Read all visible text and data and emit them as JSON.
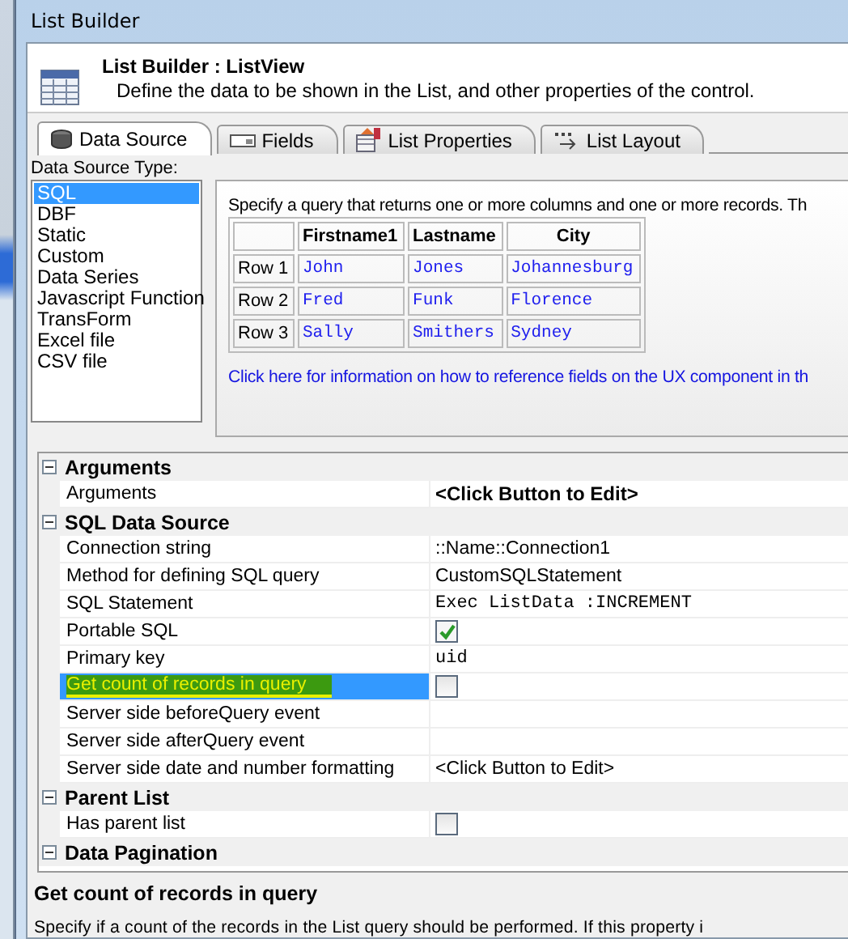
{
  "window": {
    "title": "List Builder"
  },
  "header": {
    "title": "List Builder : ListView",
    "description": "Define the data to be shown in the List, and other properties of the control."
  },
  "tabs": [
    {
      "label": "Data Source",
      "selected": true
    },
    {
      "label": "Fields",
      "selected": false
    },
    {
      "label": "List Properties",
      "selected": false
    },
    {
      "label": "List Layout",
      "selected": false
    }
  ],
  "data_source_type": {
    "label": "Data Source Type:",
    "items": [
      {
        "label": "SQL",
        "selected": true
      },
      {
        "label": "DBF",
        "selected": false
      },
      {
        "label": "Static",
        "selected": false
      },
      {
        "label": "Custom",
        "selected": false
      },
      {
        "label": "Data Series",
        "selected": false
      },
      {
        "label": "Javascript Function",
        "selected": false
      },
      {
        "label": "TransForm",
        "selected": false
      },
      {
        "label": "Excel file",
        "selected": false
      },
      {
        "label": "CSV file",
        "selected": false
      }
    ]
  },
  "info_panel": {
    "intro": "Specify a query that returns one or more columns and one or more records. Th",
    "sample_table": {
      "columns": [
        "Firstname1",
        "Lastname",
        "City"
      ],
      "rows": [
        {
          "label": "Row 1",
          "cells": [
            "John",
            "Jones",
            "Johannesburg"
          ]
        },
        {
          "label": "Row 2",
          "cells": [
            "Fred",
            "Funk",
            "Florence"
          ]
        },
        {
          "label": "Row 3",
          "cells": [
            "Sally",
            "Smithers",
            "Sydney"
          ]
        }
      ]
    },
    "link": "Click here for information on how to reference fields on the UX component in th"
  },
  "properties": [
    {
      "category": "Arguments",
      "expanded": true,
      "rows": [
        {
          "label": "Arguments",
          "kind": "bold",
          "value": "<Click Button to Edit>",
          "selected": false
        }
      ]
    },
    {
      "category": "SQL Data Source",
      "expanded": true,
      "rows": [
        {
          "label": "Connection string",
          "kind": "text",
          "value": "::Name::Connection1",
          "selected": false
        },
        {
          "label": "Method for defining SQL query",
          "kind": "text",
          "value": "CustomSQLStatement",
          "selected": false
        },
        {
          "label": "SQL Statement",
          "kind": "mono",
          "value": "Exec ListData :INCREMENT",
          "selected": false
        },
        {
          "label": "Portable SQL",
          "kind": "checkbox",
          "checked": true,
          "selected": false
        },
        {
          "label": "Primary key",
          "kind": "mono",
          "value": "uid",
          "selected": false
        },
        {
          "label": "Get count of records in query",
          "kind": "checkbox",
          "checked": false,
          "selected": true
        },
        {
          "label": "Server side beforeQuery event",
          "kind": "text",
          "selected": false
        },
        {
          "label": "Server side afterQuery event",
          "kind": "text",
          "selected": false
        },
        {
          "label": "Server side date and number formatting",
          "kind": "text",
          "value": "<Click Button to Edit>",
          "selected": false
        }
      ]
    },
    {
      "category": "Parent List",
      "expanded": true,
      "rows": [
        {
          "label": "Has parent list",
          "kind": "checkbox",
          "checked": false,
          "selected": false
        }
      ]
    },
    {
      "category": "Data Pagination",
      "expanded": true
    }
  ],
  "help": {
    "title": "Get count of records in query",
    "text": "Specify if a count of the records in the List query should be performed. If this property i"
  }
}
